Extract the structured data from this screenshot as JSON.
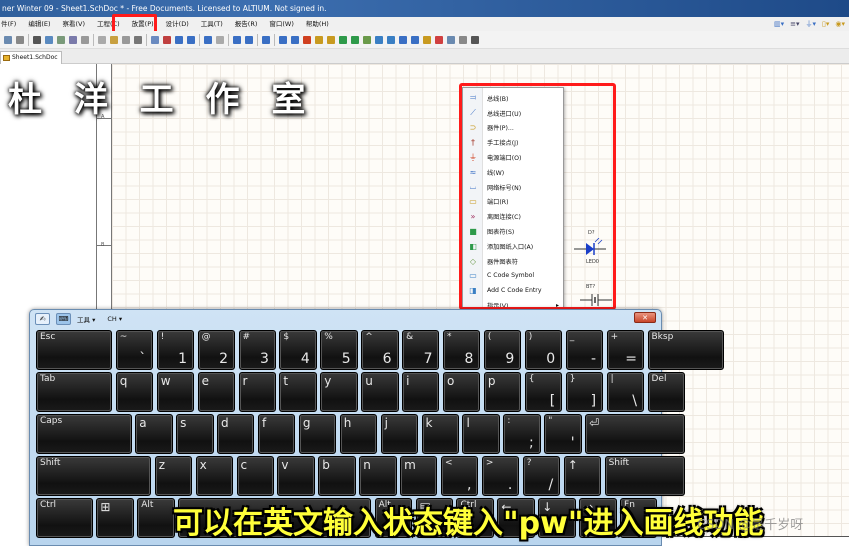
{
  "window": {
    "title": "ner Winter 09 - Sheet1.SchDoc * - Free Documents. Licensed to ALTIUM. Not signed in."
  },
  "menubar": {
    "items": [
      "件(F)",
      "编辑(E)",
      "察看(V)",
      "工程(C)",
      "放置(P)",
      "设计(D)",
      "工具(T)",
      "报告(R)",
      "窗口(W)",
      "帮助(H)"
    ],
    "highlighted": "放置(P)"
  },
  "tabs": [
    {
      "label": "Sheet1.SchDoc *"
    }
  ],
  "watermark": {
    "studio": "杜 洋 工 作 室"
  },
  "ruler": {
    "zones": [
      "A",
      "B"
    ]
  },
  "place_menu": {
    "items": [
      {
        "icon": "bus-icon",
        "glyph": "⫤",
        "color": "#3a6fc4",
        "label": "总线(B)"
      },
      {
        "icon": "bus-entry-icon",
        "glyph": "⟋",
        "color": "#3a6fc4",
        "label": "总线进口(U)"
      },
      {
        "icon": "part-icon",
        "glyph": "⊃",
        "color": "#c89a20",
        "label": "器件(P)..."
      },
      {
        "icon": "junction-icon",
        "glyph": "†",
        "color": "#a03020",
        "label": "手工接点(J)"
      },
      {
        "icon": "power-port-icon",
        "glyph": "⏚",
        "color": "#d04020",
        "label": "电源端口(O)"
      },
      {
        "icon": "wire-icon",
        "glyph": "≈",
        "color": "#3a6fc4",
        "label": "线(W)"
      },
      {
        "icon": "net-label-icon",
        "glyph": "⌴",
        "color": "#3a6fc4",
        "label": "网络标号(N)"
      },
      {
        "icon": "port-icon",
        "glyph": "▭",
        "color": "#c89a20",
        "label": "端口(R)"
      },
      {
        "icon": "off-sheet-connector-icon",
        "glyph": "»",
        "color": "#a03060",
        "label": "离图连接(C)"
      },
      {
        "icon": "sheet-symbol-icon",
        "glyph": "■",
        "color": "#2e9a4a",
        "label": "图表符(S)"
      },
      {
        "icon": "sheet-entry-icon",
        "glyph": "◧",
        "color": "#2e9a4a",
        "label": "添加图纸入口(A)"
      },
      {
        "icon": "device-sheet-symbol-icon",
        "glyph": "◇",
        "color": "#6a9a4a",
        "label": "器件图表符"
      },
      {
        "icon": "c-code-symbol-icon",
        "glyph": "▭",
        "color": "#3a7fc4",
        "label": "C Code Symbol"
      },
      {
        "icon": "c-code-entry-icon",
        "glyph": "◨",
        "color": "#3a7fc4",
        "label": "Add C Code Entry"
      },
      {
        "icon": "directives-icon",
        "glyph": "",
        "color": "#333",
        "label": "指示(V)",
        "submenu": true
      }
    ]
  },
  "schematic": {
    "components": [
      {
        "designator": "D?",
        "value": "LED0"
      },
      {
        "designator": "BT?",
        "value": ""
      }
    ]
  },
  "osk": {
    "toolbar": {
      "tools_label": "工具",
      "lang_label": "CH"
    },
    "rows": [
      [
        {
          "top": "Esc",
          "w": 2
        },
        {
          "top": "~",
          "bottom": "`"
        },
        {
          "top": "!",
          "bottom": "1"
        },
        {
          "top": "@",
          "bottom": "2"
        },
        {
          "top": "#",
          "bottom": "3"
        },
        {
          "top": "$",
          "bottom": "4"
        },
        {
          "top": "%",
          "bottom": "5"
        },
        {
          "top": "^",
          "bottom": "6"
        },
        {
          "top": "&",
          "bottom": "7"
        },
        {
          "top": "*",
          "bottom": "8"
        },
        {
          "top": "(",
          "bottom": "9"
        },
        {
          "top": ")",
          "bottom": "0"
        },
        {
          "top": "_",
          "bottom": "-"
        },
        {
          "top": "+",
          "bottom": "="
        },
        {
          "top": "Bksp",
          "w": 2
        }
      ],
      [
        {
          "top": "Tab",
          "w": 2
        },
        {
          "top": "q"
        },
        {
          "top": "w"
        },
        {
          "top": "e"
        },
        {
          "top": "r"
        },
        {
          "top": "t"
        },
        {
          "top": "y"
        },
        {
          "top": "u"
        },
        {
          "top": "i"
        },
        {
          "top": "o"
        },
        {
          "top": "p"
        },
        {
          "top": "{",
          "bottom": "["
        },
        {
          "top": "}",
          "bottom": "]"
        },
        {
          "top": "|",
          "bottom": "\\"
        },
        {
          "top": "Del",
          "w": 1
        }
      ],
      [
        {
          "top": "Caps",
          "w": 2.5
        },
        {
          "top": "a"
        },
        {
          "top": "s"
        },
        {
          "top": "d"
        },
        {
          "top": "f"
        },
        {
          "top": "g"
        },
        {
          "top": "h"
        },
        {
          "top": "j"
        },
        {
          "top": "k"
        },
        {
          "top": "l"
        },
        {
          "top": ":",
          "bottom": ";"
        },
        {
          "top": "\"",
          "bottom": "'"
        },
        {
          "top": "⏎",
          "w": 2.6
        }
      ],
      [
        {
          "top": "Shift",
          "w": 3
        },
        {
          "top": "z"
        },
        {
          "top": "x"
        },
        {
          "top": "c"
        },
        {
          "top": "v"
        },
        {
          "top": "b"
        },
        {
          "top": "n"
        },
        {
          "top": "m"
        },
        {
          "top": "<",
          "bottom": ","
        },
        {
          "top": ">",
          "bottom": "."
        },
        {
          "top": "?",
          "bottom": "/"
        },
        {
          "top": "↑"
        },
        {
          "top": "Shift",
          "w": 2.1
        }
      ],
      [
        {
          "top": "Ctrl",
          "w": 1.5
        },
        {
          "top": "⊞"
        },
        {
          "top": "Alt"
        },
        {
          "top": "",
          "w": 5
        },
        {
          "top": "Alt"
        },
        {
          "top": "▤"
        },
        {
          "top": "Ctrl"
        },
        {
          "top": "←"
        },
        {
          "top": "↓"
        },
        {
          "top": "→"
        },
        {
          "top": "Fn"
        }
      ]
    ]
  },
  "subtitle": "可以在英文输入状态键入\"pw\"进入画线功能",
  "source_watermark": "CSDN @是千岁呀"
}
